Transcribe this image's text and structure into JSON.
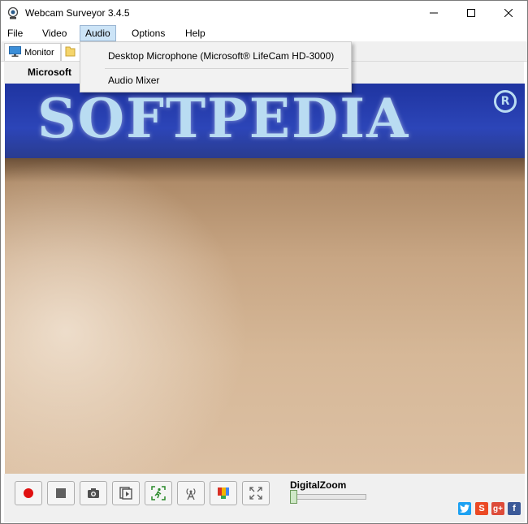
{
  "window": {
    "title": "Webcam Surveyor 3.4.5"
  },
  "menubar": {
    "file": "File",
    "video": "Video",
    "audio": "Audio",
    "options": "Options",
    "help": "Help"
  },
  "tabs": [
    {
      "label": "Monitor",
      "icon": "monitor-icon",
      "selected": true
    },
    {
      "label": "",
      "icon": "folder-icon",
      "selected": false
    }
  ],
  "camera": {
    "name_visible": "Microsoft"
  },
  "video_feed": {
    "banner_text": "SOFTPEDIA",
    "banner_mark": "R"
  },
  "audio_menu": {
    "items": [
      {
        "label": "Desktop Microphone (Microsoft® LifeCam HD-3000)"
      },
      {
        "label": "Audio Mixer"
      }
    ]
  },
  "toolbar": {
    "buttons": [
      {
        "icon": "record-icon",
        "color": "#e01010"
      },
      {
        "icon": "stop-icon",
        "color": "#606060"
      },
      {
        "icon": "camera-icon",
        "color": "#505050"
      },
      {
        "icon": "playback-icon",
        "color": "#505050"
      },
      {
        "icon": "motion-detect-icon",
        "color": "#2a8a2a"
      },
      {
        "icon": "broadcast-icon",
        "color": "#606060"
      },
      {
        "icon": "color-settings-icon",
        "color": "#d93025"
      },
      {
        "icon": "fullscreen-icon",
        "color": "#606060"
      }
    ],
    "zoom": {
      "label": "DigitalZoom",
      "level": 0
    }
  },
  "social": [
    {
      "icon": "twitter-icon",
      "glyph": "t",
      "color": "#1da1f2"
    },
    {
      "icon": "stumbleupon-icon",
      "glyph": "S",
      "color": "#eb4924"
    },
    {
      "icon": "google-plus-icon",
      "glyph": "g+",
      "color": "#dd4b39"
    },
    {
      "icon": "facebook-icon",
      "glyph": "f",
      "color": "#3b5998"
    }
  ],
  "colors": {
    "menu_highlight": "#cce4f7",
    "dialog_bg": "#f0f0f0"
  }
}
